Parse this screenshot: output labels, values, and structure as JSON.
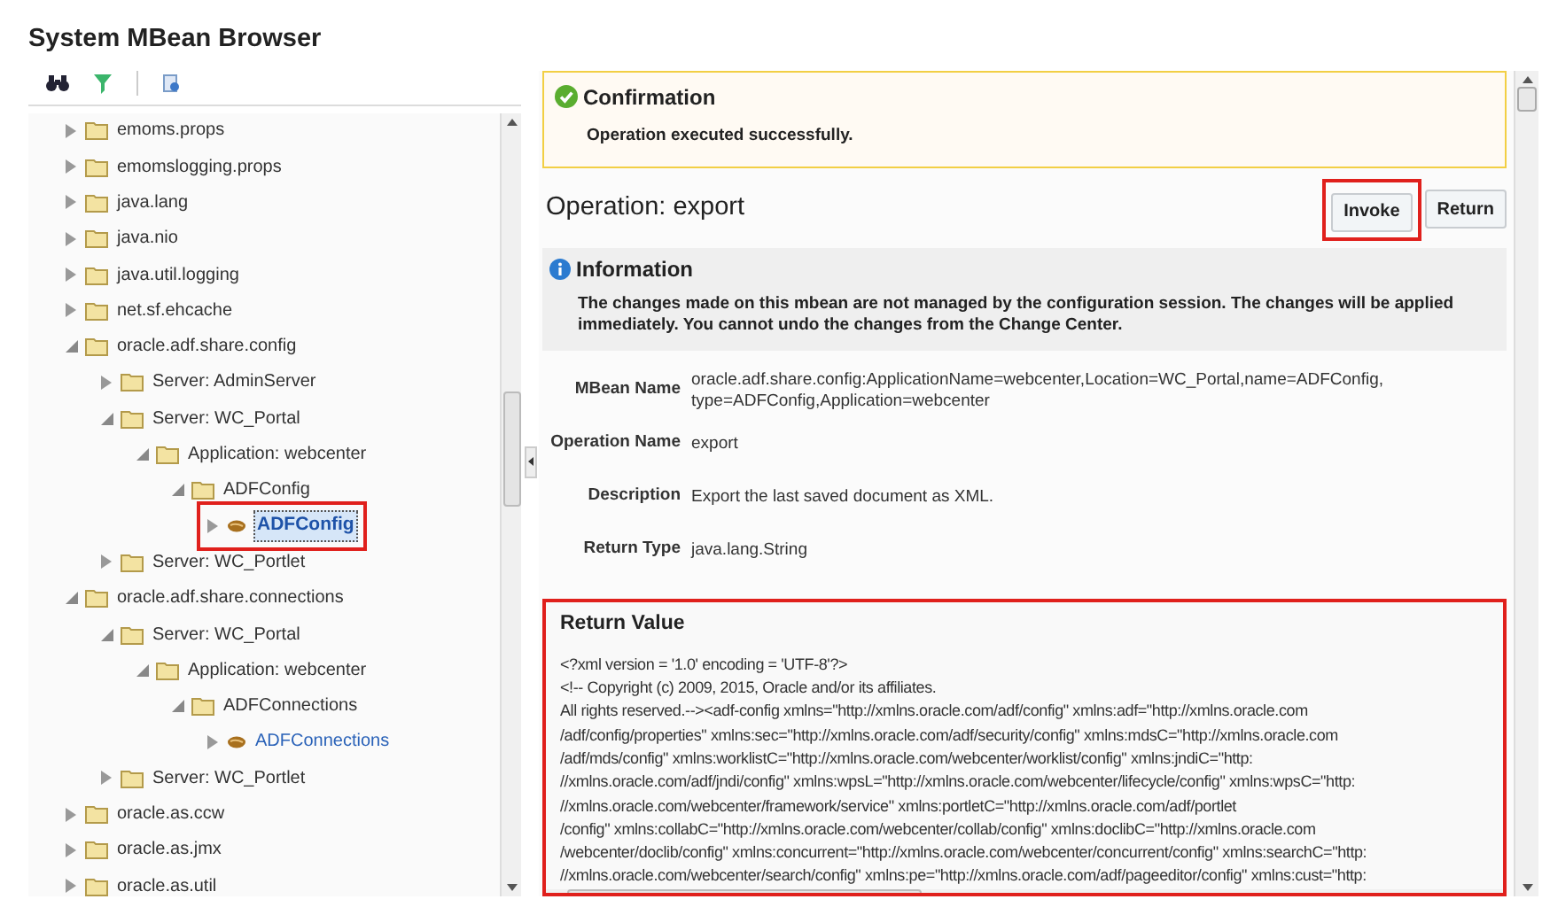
{
  "title": "System MBean Browser",
  "tree": [
    {
      "label": "emoms.props",
      "kind": "folder",
      "expanded": false,
      "selected": false
    },
    {
      "label": "emomslogging.props",
      "kind": "folder",
      "expanded": false,
      "selected": false
    },
    {
      "label": "java.lang",
      "kind": "folder",
      "expanded": false,
      "selected": false
    },
    {
      "label": "java.nio",
      "kind": "folder",
      "expanded": false,
      "selected": false
    },
    {
      "label": "java.util.logging",
      "kind": "folder",
      "expanded": false,
      "selected": false
    },
    {
      "label": "net.sf.ehcache",
      "kind": "folder",
      "expanded": false,
      "selected": false
    },
    {
      "label": "oracle.adf.share.config",
      "kind": "folder",
      "expanded": true,
      "selected": false,
      "children": [
        {
          "label": "Server: AdminServer",
          "kind": "folder",
          "expanded": false,
          "selected": false
        },
        {
          "label": "Server: WC_Portal",
          "kind": "folder",
          "expanded": true,
          "selected": false,
          "children": [
            {
              "label": "Application: webcenter",
              "kind": "folder",
              "expanded": true,
              "selected": false,
              "children": [
                {
                  "label": "ADFConfig",
                  "kind": "folder",
                  "expanded": true,
                  "selected": false,
                  "children": [
                    {
                      "label": "ADFConfig",
                      "kind": "bean",
                      "expanded": false,
                      "selected": true,
                      "highlighted": true
                    }
                  ]
                }
              ]
            }
          ]
        },
        {
          "label": "Server: WC_Portlet",
          "kind": "folder",
          "expanded": false,
          "selected": false
        }
      ]
    },
    {
      "label": "oracle.adf.share.connections",
      "kind": "folder",
      "expanded": true,
      "selected": false,
      "children": [
        {
          "label": "Server: WC_Portal",
          "kind": "folder",
          "expanded": true,
          "selected": false,
          "children": [
            {
              "label": "Application: webcenter",
              "kind": "folder",
              "expanded": true,
              "selected": false,
              "children": [
                {
                  "label": "ADFConnections",
                  "kind": "folder",
                  "expanded": true,
                  "selected": false,
                  "children": [
                    {
                      "label": "ADFConnections",
                      "kind": "bean",
                      "expanded": false,
                      "selected": false
                    }
                  ]
                }
              ]
            }
          ]
        },
        {
          "label": "Server: WC_Portlet",
          "kind": "folder",
          "expanded": false,
          "selected": false
        }
      ]
    },
    {
      "label": "oracle.as.ccw",
      "kind": "folder",
      "expanded": false,
      "selected": false
    },
    {
      "label": "oracle.as.jmx",
      "kind": "folder",
      "expanded": false,
      "selected": false
    },
    {
      "label": "oracle.as.util",
      "kind": "folder",
      "expanded": false,
      "selected": false
    }
  ],
  "confirmation": {
    "title": "Confirmation",
    "message": "Operation executed successfully."
  },
  "operation": {
    "title": "Operation: export",
    "buttons": [
      {
        "label": "Invoke",
        "highlighted": true
      },
      {
        "label": "Return",
        "highlighted": false
      }
    ]
  },
  "information": {
    "title": "Information",
    "message": "The changes made on this mbean are not managed by the configuration session. The changes will be applied immediately. You cannot undo the changes from the Change Center."
  },
  "fields": [
    {
      "label": "MBean Name",
      "value": "oracle.adf.share.config:ApplicationName=webcenter,Location=WC_Portal,name=ADFConfig, type=ADFConfig,Application=webcenter"
    },
    {
      "label": "Operation Name",
      "value": "export"
    },
    {
      "label": "Description",
      "value": "Export the last saved document as XML."
    },
    {
      "label": "Return Type",
      "value": "java.lang.String"
    }
  ],
  "return_value": {
    "title": "Return Value",
    "highlighted": true,
    "lines": [
      "<?xml version = '1.0' encoding = 'UTF-8'?>",
      "<!-- Copyright (c) 2009, 2015, Oracle and/or its affiliates.",
      "All rights reserved.--><adf-config xmlns=\"http://xmlns.oracle.com/adf/config\" xmlns:adf=\"http://xmlns.oracle.com",
      "/adf/config/properties\" xmlns:sec=\"http://xmlns.oracle.com/adf/security/config\" xmlns:mdsC=\"http://xmlns.oracle.com",
      "/adf/mds/config\" xmlns:worklistC=\"http://xmlns.oracle.com/webcenter/worklist/config\" xmlns:jndiC=\"http:",
      "//xmlns.oracle.com/adf/jndi/config\" xmlns:wpsL=\"http://xmlns.oracle.com/webcenter/lifecycle/config\" xmlns:wpsC=\"http:",
      "//xmlns.oracle.com/webcenter/framework/service\" xmlns:portletC=\"http://xmlns.oracle.com/adf/portlet",
      "/config\" xmlns:collabC=\"http://xmlns.oracle.com/webcenter/collab/config\" xmlns:doclibC=\"http://xmlns.oracle.com",
      "/webcenter/doclib/config\" xmlns:concurrent=\"http://xmlns.oracle.com/webcenter/concurrent/config\" xmlns:searchC=\"http:",
      "//xmlns.oracle.com/webcenter/search/config\" xmlns:pe=\"http://xmlns.oracle.com/adf/pageeditor/config\" xmlns:cust=\"http:"
    ]
  }
}
